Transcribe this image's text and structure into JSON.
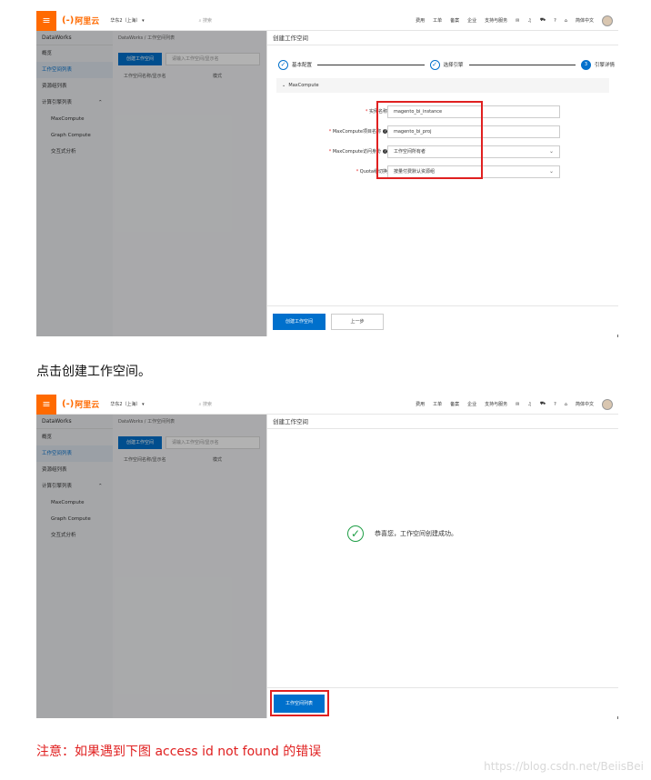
{
  "console": {
    "menu_icon": "hamburger-icon",
    "logo_text": "阿里云",
    "logo_icon": "aliyun-bracket-icon",
    "region": "华东2（上海）",
    "search_placeholder": "搜索",
    "nav_items": [
      "费用",
      "工单",
      "备案",
      "企业",
      "支持与服务"
    ],
    "nav_icons": [
      "mail-icon",
      "bell-icon",
      "cart-icon",
      "help-icon",
      "home-icon"
    ],
    "language": "简体中文"
  },
  "sidebar": {
    "title": "DataWorks",
    "items": [
      {
        "label": "概览",
        "active": false,
        "sub": false
      },
      {
        "label": "工作空间列表",
        "active": true,
        "sub": false
      },
      {
        "label": "资源组列表",
        "active": false,
        "sub": false
      },
      {
        "label": "计算引擎列表",
        "active": false,
        "sub": false,
        "expanded": true
      },
      {
        "label": "MaxCompute",
        "active": false,
        "sub": true
      },
      {
        "label": "Graph Compute",
        "active": false,
        "sub": true
      },
      {
        "label": "交互式分析",
        "active": false,
        "sub": true
      }
    ]
  },
  "workspace_list": {
    "breadcrumb": "DataWorks / 工作空间列表",
    "create_button": "创建工作空间",
    "search_placeholder": "请输入工作空间/显示名",
    "columns": [
      "工作空间名称/显示名",
      "模式"
    ]
  },
  "shot1": {
    "panel_title": "创建工作空间",
    "steps": [
      {
        "label": "基本配置",
        "state": "done"
      },
      {
        "label": "选择引擎",
        "state": "done"
      },
      {
        "label": "引擎详情",
        "state": "current",
        "number": "3"
      }
    ],
    "section_title": "MaxCompute",
    "fields": [
      {
        "label": "实例名称",
        "value": "magento_bi_instance",
        "type": "text",
        "help": false
      },
      {
        "label": "MaxCompute项目名称",
        "value": "magento_bi_proj",
        "type": "text",
        "help": true
      },
      {
        "label": "MaxCompute访问身份",
        "value": "工作空间所有者",
        "type": "select",
        "help": true
      },
      {
        "label": "Quota组切换",
        "value": "按量付费默认资源组",
        "type": "select",
        "help": false
      }
    ],
    "create_button": "创建工作空间",
    "prev_button": "上一步"
  },
  "caption": "点击创建工作空间。",
  "shot2": {
    "panel_title": "创建工作空间",
    "success_text": "恭喜您，工作空间创建成功。",
    "list_button": "工作空间列表"
  },
  "note": "注意：如果遇到下图 access id not found 的错误",
  "watermark": "https://blog.csdn.net/BeiisBei",
  "colors": {
    "brand": "#ff6a00",
    "primary": "#0070cc",
    "highlight": "#e02020",
    "success": "#1e9e45"
  }
}
